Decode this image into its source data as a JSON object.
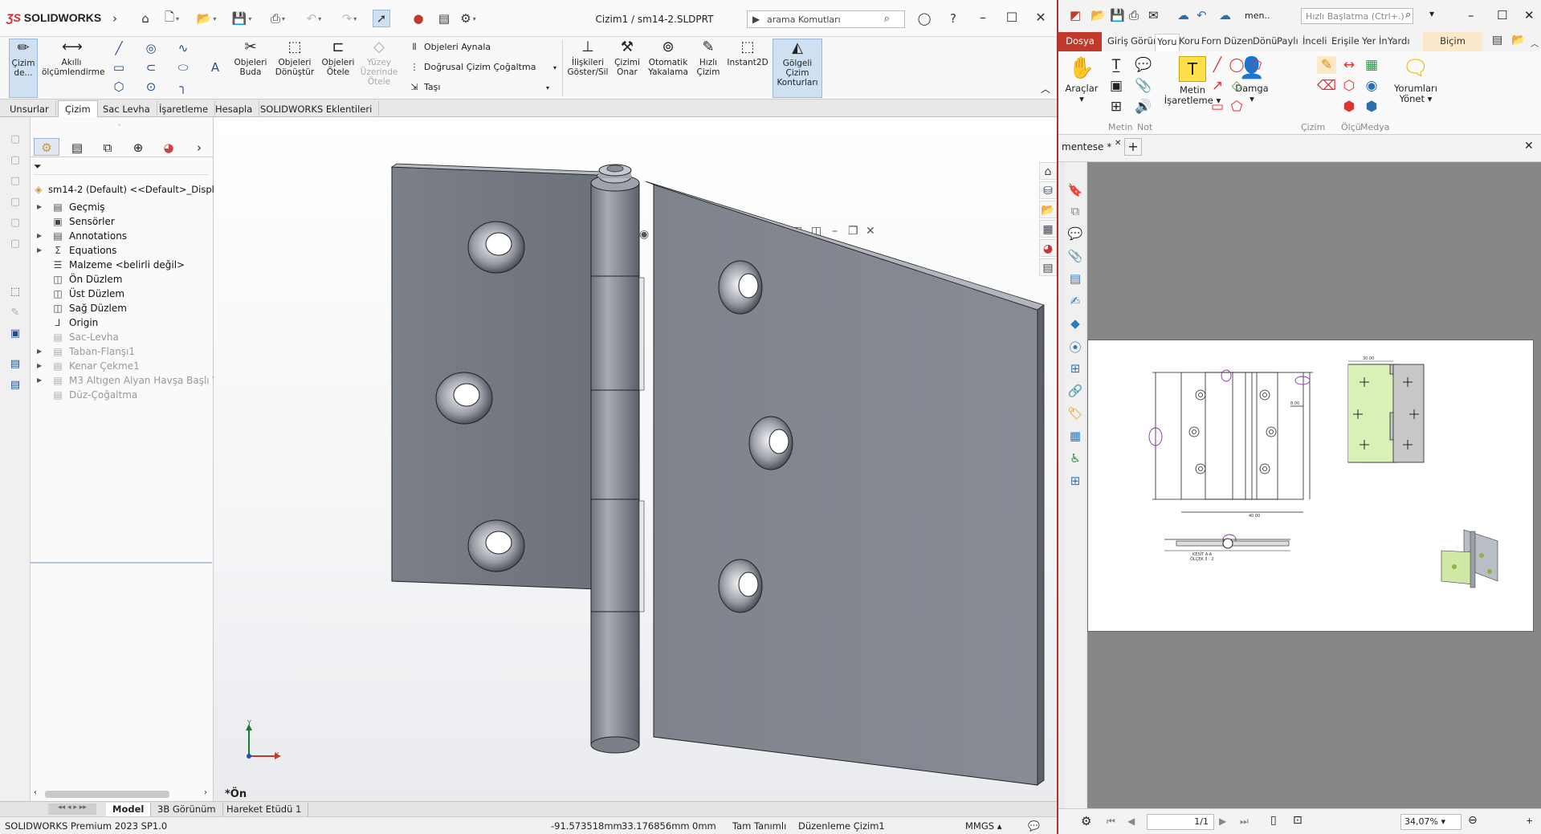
{
  "sw": {
    "brand": "SOLIDWORKS",
    "doc_title": "Cizim1 / sm14-2.SLDPRT",
    "search_placeholder": "arama Komutları",
    "command_buttons": {
      "sketch": "Çizim de...",
      "smart_dim": "Akıllı ölçümlendirme",
      "trim": "Objeleri Buda",
      "convert": "Objeleri Dönüştür",
      "offset": "Objeleri Ötele",
      "surface_offset": "Yüzey Üzerinde Ötele",
      "mirror": "Objeleri Aynala",
      "linear_pattern": "Doğrusal Çizim Çoğaltma",
      "move": "Taşı",
      "relations": "İlişkileri Göster/Sil",
      "repair": "Çizimi Onar",
      "quick_snaps": "Otomatik Yakalama",
      "rapid_sketch": "Hızlı Çizim",
      "instant2d": "Instant2D",
      "shaded_contours": "Gölgeli Çizim Konturları"
    },
    "tabs": [
      "Unsurlar",
      "Çizim",
      "Sac Levha",
      "İşaretleme",
      "Hesapla",
      "SOLIDWORKS Eklentileri"
    ],
    "active_tab": "Çizim",
    "tree": {
      "root": "sm14-2 (Default) <<Default>_Display",
      "items": [
        {
          "label": "Geçmiş",
          "expand": true,
          "grey": false
        },
        {
          "label": "Sensörler",
          "expand": false,
          "grey": false
        },
        {
          "label": "Annotations",
          "expand": true,
          "grey": false
        },
        {
          "label": "Equations",
          "expand": true,
          "grey": false
        },
        {
          "label": "Malzeme <belirli değil>",
          "expand": false,
          "grey": false
        },
        {
          "label": "Ön Düzlem",
          "expand": false,
          "grey": false
        },
        {
          "label": "Üst Düzlem",
          "expand": false,
          "grey": false
        },
        {
          "label": "Sağ Düzlem",
          "expand": false,
          "grey": false
        },
        {
          "label": "Origin",
          "expand": false,
          "grey": false
        },
        {
          "label": "Sac-Levha",
          "expand": false,
          "grey": true
        },
        {
          "label": "Taban-Flanşı1",
          "expand": true,
          "grey": true
        },
        {
          "label": "Kenar Çekme1",
          "expand": true,
          "grey": true
        },
        {
          "label": "M3 Altıgen Alyan Havşa Başlı Vida",
          "expand": true,
          "grey": true
        },
        {
          "label": "Düz-Çoğaltma",
          "expand": false,
          "grey": true
        }
      ]
    },
    "view_name": "*Ön",
    "bottom_tabs": [
      "Model",
      "3B Görünüm",
      "Hareket Etüdü 1"
    ],
    "status": {
      "product": "SOLIDWORKS Premium 2023 SP1.0",
      "x": "-91.573518mm",
      "y": "33.176856mm",
      "z": "0mm",
      "state": "Tam Tanımlı",
      "mode": "Düzenleme Çizim1",
      "units": "MMGS"
    },
    "triad": {
      "y": "Y",
      "x": "X"
    }
  },
  "pdf": {
    "quick_search": "Hızlı Başlatma (Ctrl+.)",
    "menu_short": "men..",
    "menu": [
      "Dosya",
      "Giriş",
      "Görür",
      "Yoru",
      "Koru",
      "Forn",
      "Düzen",
      "Dönü",
      "Paylı",
      "İnceli",
      "Erişile",
      "Yer İn",
      "Yardı",
      "Biçim"
    ],
    "ribbon": {
      "tools": "Araçlar",
      "text_group": "Metin",
      "note_group": "Not",
      "text_markup": "Metin İşaretleme",
      "stamp": "Damga",
      "drawing_group": "Çizim",
      "measure_group": "Ölçü",
      "media_group": "Medya",
      "manage_comments": "Yorumları Yönet"
    },
    "doc_tab": "mentese *",
    "page_indicator": "1/1",
    "zoom": "34,07%",
    "drawing": {
      "dims": [
        "30.00",
        "40.00",
        "8.00",
        "30.00",
        "2.50",
        "9.40"
      ],
      "section_label": "KESİT A-A",
      "scale_label": "ÖLÇEK 3 : 2"
    }
  }
}
